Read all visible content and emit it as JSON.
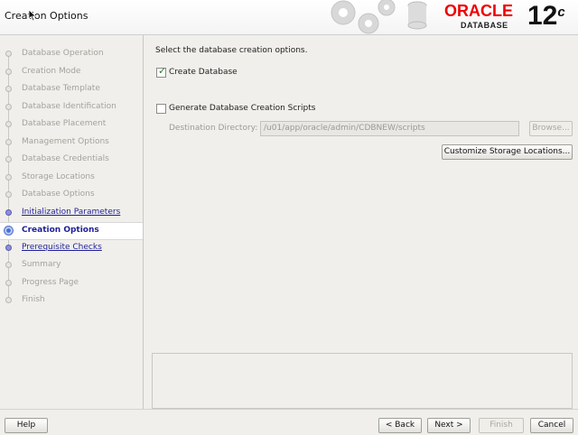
{
  "header": {
    "title": "Creation Options",
    "brand": "ORACLE",
    "brand_sub": "DATABASE",
    "version": "12",
    "version_suffix": "c"
  },
  "sidebar": {
    "steps": [
      {
        "label": "Database Operation",
        "state": "done"
      },
      {
        "label": "Creation Mode",
        "state": "done"
      },
      {
        "label": "Database Template",
        "state": "done"
      },
      {
        "label": "Database Identification",
        "state": "done"
      },
      {
        "label": "Database Placement",
        "state": "done"
      },
      {
        "label": "Management Options",
        "state": "done"
      },
      {
        "label": "Database Credentials",
        "state": "done"
      },
      {
        "label": "Storage Locations",
        "state": "done"
      },
      {
        "label": "Database Options",
        "state": "done"
      },
      {
        "label": "Initialization Parameters",
        "state": "link"
      },
      {
        "label": "Creation Options",
        "state": "current"
      },
      {
        "label": "Prerequisite Checks",
        "state": "link"
      },
      {
        "label": "Summary",
        "state": "pending"
      },
      {
        "label": "Progress Page",
        "state": "pending"
      },
      {
        "label": "Finish",
        "state": "pending"
      }
    ]
  },
  "main": {
    "instruction": "Select the database creation options.",
    "create_database": {
      "label": "Create Database",
      "checked": true
    },
    "generate_scripts": {
      "label": "Generate Database Creation Scripts",
      "checked": false
    },
    "destination": {
      "label": "Destination Directory:",
      "value": "/u01/app/oracle/admin/CDBNEW/scripts"
    },
    "browse_label": "Browse...",
    "customize_label": "Customize Storage Locations..."
  },
  "footer": {
    "help": "Help",
    "back": "< Back",
    "next": "Next >",
    "finish": "Finish",
    "cancel": "Cancel"
  },
  "colors": {
    "brand_red": "#ee0000",
    "link_blue": "#1f1f9a",
    "check_green": "#2a7a2a"
  }
}
